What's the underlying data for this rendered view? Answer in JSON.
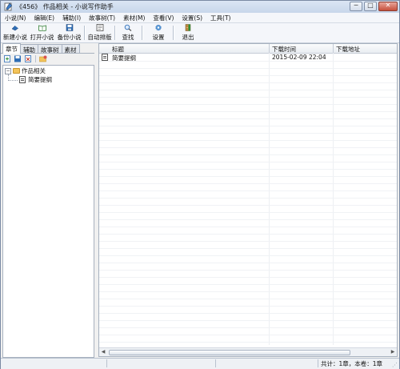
{
  "window": {
    "title": "《456》 作品相关 - 小说写作助手",
    "controls": {
      "minimize": "─",
      "maximize": "□",
      "close": "✕"
    }
  },
  "menu": [
    "小说(N)",
    "编辑(E)",
    "辅助(I)",
    "故事树(T)",
    "素材(M)",
    "查看(V)",
    "设置(S)",
    "工具(T)"
  ],
  "toolbar": {
    "new_novel": "新建小说",
    "open_novel": "打开小说",
    "backup_novel": "备份小说",
    "auto_layout": "自动排版",
    "find": "查找",
    "settings": "设置",
    "exit": "退出"
  },
  "left_tabs": [
    "章节",
    "辅助",
    "故事树",
    "素材"
  ],
  "tree": {
    "root": "作品相关",
    "child": "简要提纲",
    "root_expander": "−"
  },
  "list": {
    "columns": [
      "标题",
      "下载时间",
      "下载地址"
    ],
    "rows": [
      {
        "title": "简要提纲",
        "time": "2015-02-09 22:04",
        "url": ""
      }
    ]
  },
  "status": {
    "count": "共计：1章，本卷：1章"
  },
  "colors": {
    "accent": "#2e6db5",
    "folder": "#f3c45a",
    "window_bg": "#f0f0f0"
  }
}
